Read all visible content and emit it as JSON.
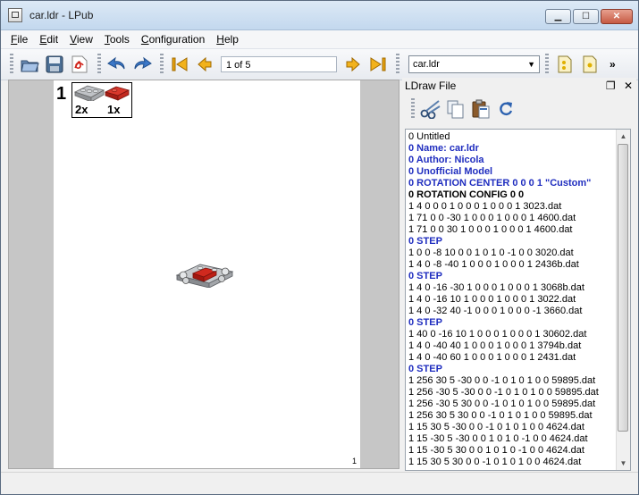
{
  "window": {
    "title": "car.ldr - LPub"
  },
  "menu": [
    {
      "key": "F",
      "rest": "ile"
    },
    {
      "key": "E",
      "rest": "dit"
    },
    {
      "key": "V",
      "rest": "iew"
    },
    {
      "key": "T",
      "rest": "ools"
    },
    {
      "key": "C",
      "rest": "onfiguration"
    },
    {
      "key": "H",
      "rest": "elp"
    }
  ],
  "toolbar": {
    "page_field": "1 of 5",
    "model_combo": "car.ldr",
    "more": "»"
  },
  "page": {
    "step_number": "1",
    "pli_qty": [
      "2x",
      "1x"
    ],
    "page_number": "1"
  },
  "dock": {
    "title": "LDraw File",
    "lines": [
      {
        "text": "0 Untitled",
        "kind": "plain"
      },
      {
        "text": "0 Name: car.ldr",
        "kind": "meta"
      },
      {
        "text": "0 Author: Nicola",
        "kind": "meta"
      },
      {
        "text": "0 Unofficial Model",
        "kind": "meta"
      },
      {
        "text": "0 ROTATION CENTER 0 0 0 1 \"Custom\"",
        "kind": "meta"
      },
      {
        "text": "0 ROTATION CONFIG 0 0",
        "kind": "bold"
      },
      {
        "text": "1 4 0 0 0 1 0 0 0 1 0 0 0 1 3023.dat",
        "kind": "plain"
      },
      {
        "text": "1 71 0 0 -30 1 0 0 0 1 0 0 0 1 4600.dat",
        "kind": "plain"
      },
      {
        "text": "1 71 0 0 30 1 0 0 0 1 0 0 0 1 4600.dat",
        "kind": "plain"
      },
      {
        "text": "0 STEP",
        "kind": "meta"
      },
      {
        "text": "1 0 0 -8 10 0 0 1 0 1 0 -1 0 0 3020.dat",
        "kind": "plain"
      },
      {
        "text": "1 4 0 -8 -40 1 0 0 0 1 0 0 0 1 2436b.dat",
        "kind": "plain"
      },
      {
        "text": "0 STEP",
        "kind": "meta"
      },
      {
        "text": "1 4 0 -16 -30 1 0 0 0 1 0 0 0 1 3068b.dat",
        "kind": "plain"
      },
      {
        "text": "1 4 0 -16 10 1 0 0 0 1 0 0 0 1 3022.dat",
        "kind": "plain"
      },
      {
        "text": "1 4 0 -32 40 -1 0 0 0 1 0 0 0 -1 3660.dat",
        "kind": "plain"
      },
      {
        "text": "0 STEP",
        "kind": "meta"
      },
      {
        "text": "1 40 0 -16 10 1 0 0 0 1 0 0 0 1 30602.dat",
        "kind": "plain"
      },
      {
        "text": "1 4 0 -40 40 1 0 0 0 1 0 0 0 1 3794b.dat",
        "kind": "plain"
      },
      {
        "text": "1 4 0 -40 60 1 0 0 0 1 0 0 0 1 2431.dat",
        "kind": "plain"
      },
      {
        "text": "0 STEP",
        "kind": "meta"
      },
      {
        "text": "1 256 30 5 -30 0 0 -1 0 1 0 1 0 0 59895.dat",
        "kind": "plain"
      },
      {
        "text": "1 256 -30 5 -30 0 0 -1 0 1 0 1 0 0 59895.dat",
        "kind": "plain"
      },
      {
        "text": "1 256 -30 5 30 0 0 -1 0 1 0 1 0 0 59895.dat",
        "kind": "plain"
      },
      {
        "text": "1 256 30 5 30 0 0 -1 0 1 0 1 0 0 59895.dat",
        "kind": "plain"
      },
      {
        "text": "1 15 30 5 -30 0 0 -1 0 1 0 1 0 0 4624.dat",
        "kind": "plain"
      },
      {
        "text": "1 15 -30 5 -30 0 0 1 0 1 0 -1 0 0 4624.dat",
        "kind": "plain"
      },
      {
        "text": "1 15 -30 5 30 0 0 1 0 1 0 -1 0 0 4624.dat",
        "kind": "plain"
      },
      {
        "text": "1 15 30 5 30 0 0 -1 0 1 0 1 0 0 4624.dat",
        "kind": "plain"
      }
    ]
  },
  "colors": {
    "meta_text": "#1f2dbf",
    "brick_red": "#c8261c",
    "part_gray": "#9c9fa3"
  },
  "icons": [
    "app-icon",
    "open-icon",
    "save-icon",
    "pdf-icon",
    "undo-icon",
    "redo-icon",
    "first-page-icon",
    "prev-page-icon",
    "next-page-icon",
    "last-page-icon",
    "page-setup-icon",
    "page-setup-alt-icon",
    "cut-icon",
    "copy-icon",
    "paste-icon",
    "refresh-icon"
  ]
}
